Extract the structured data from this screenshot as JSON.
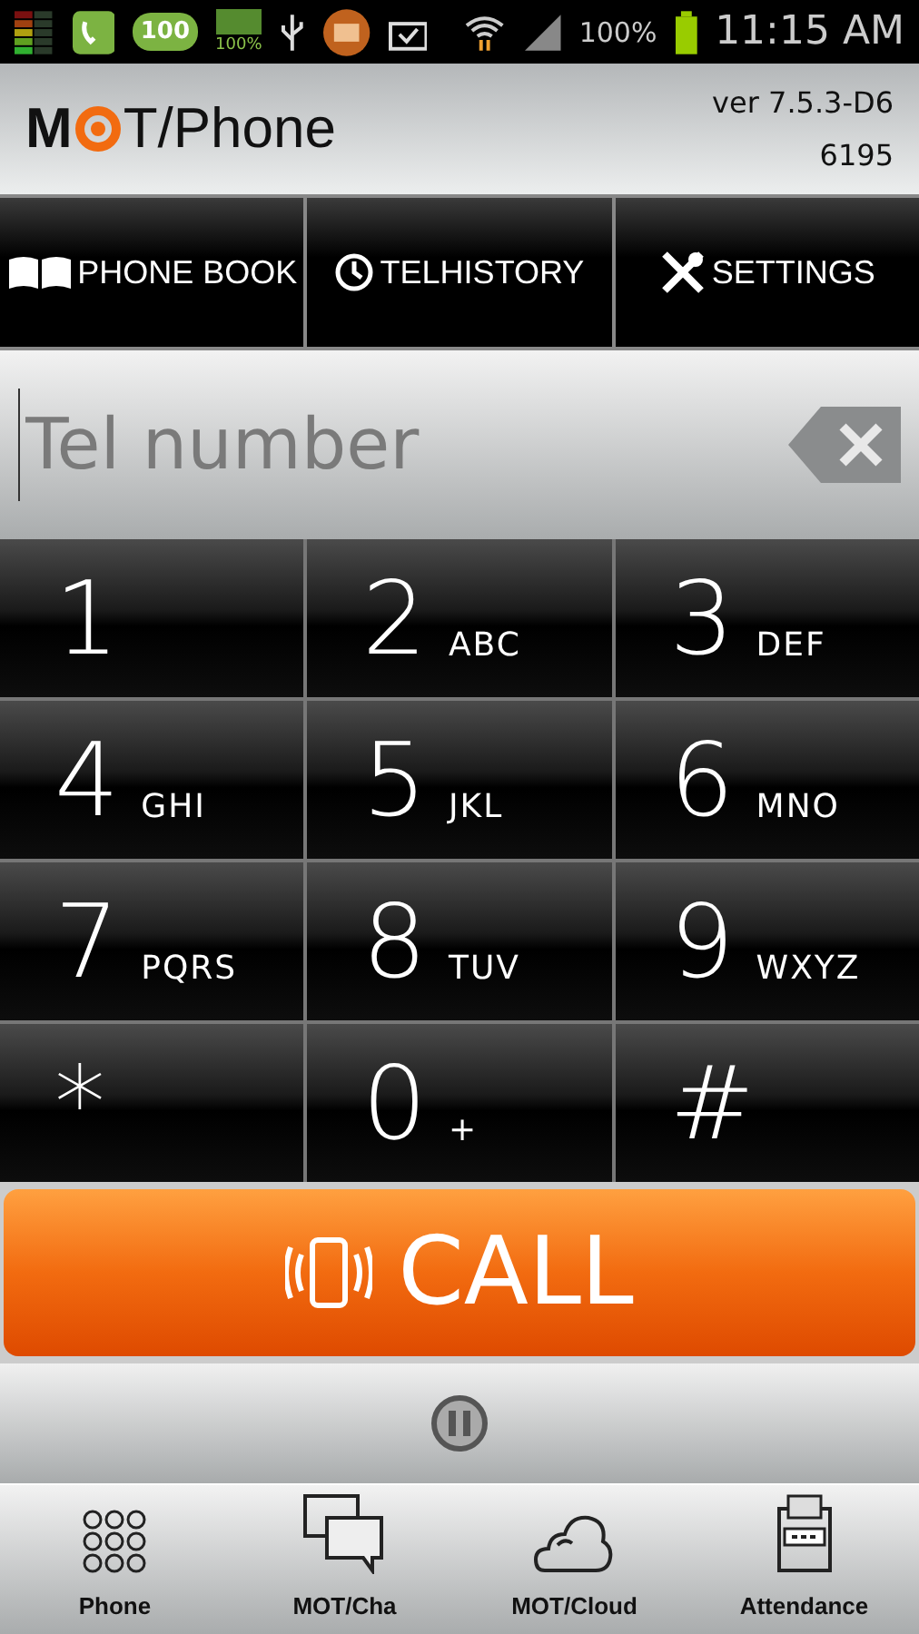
{
  "status_bar": {
    "frog_badge": "100",
    "battery_small": "100%",
    "battery_percent": "100%",
    "time": "11:15 AM"
  },
  "header": {
    "logo_left": "M",
    "logo_right": "T/Phone",
    "version": "ver 7.5.3-D6",
    "extension": "6195"
  },
  "function_buttons": [
    {
      "kind": "book",
      "label": "PHONE BOOK"
    },
    {
      "kind": "clock",
      "label": "TELHISTORY"
    },
    {
      "kind": "tools",
      "label": "SETTINGS"
    }
  ],
  "number_field": {
    "placeholder": "Tel number"
  },
  "keypad": [
    {
      "digit": "1"
    },
    {
      "digit": "2",
      "letters": "ABC"
    },
    {
      "digit": "3",
      "letters": "DEF"
    },
    {
      "digit": "4",
      "letters": "GHI"
    },
    {
      "digit": "5",
      "letters": "JKL"
    },
    {
      "digit": "6",
      "letters": "MNO"
    },
    {
      "digit": "7",
      "letters": "PQRS"
    },
    {
      "digit": "8",
      "letters": "TUV"
    },
    {
      "digit": "9",
      "letters": "WXYZ"
    },
    {
      "digit": "*"
    },
    {
      "digit": "0",
      "letters": "+"
    },
    {
      "digit": "#"
    }
  ],
  "call_button": {
    "label": "CALL"
  },
  "tabs": [
    {
      "kind": "dialpad",
      "label": "Phone"
    },
    {
      "kind": "chat",
      "label": "MOT/Cha"
    },
    {
      "kind": "cloud",
      "label": "MOT/Cloud"
    },
    {
      "kind": "clock_card",
      "label": "Attendance"
    }
  ]
}
